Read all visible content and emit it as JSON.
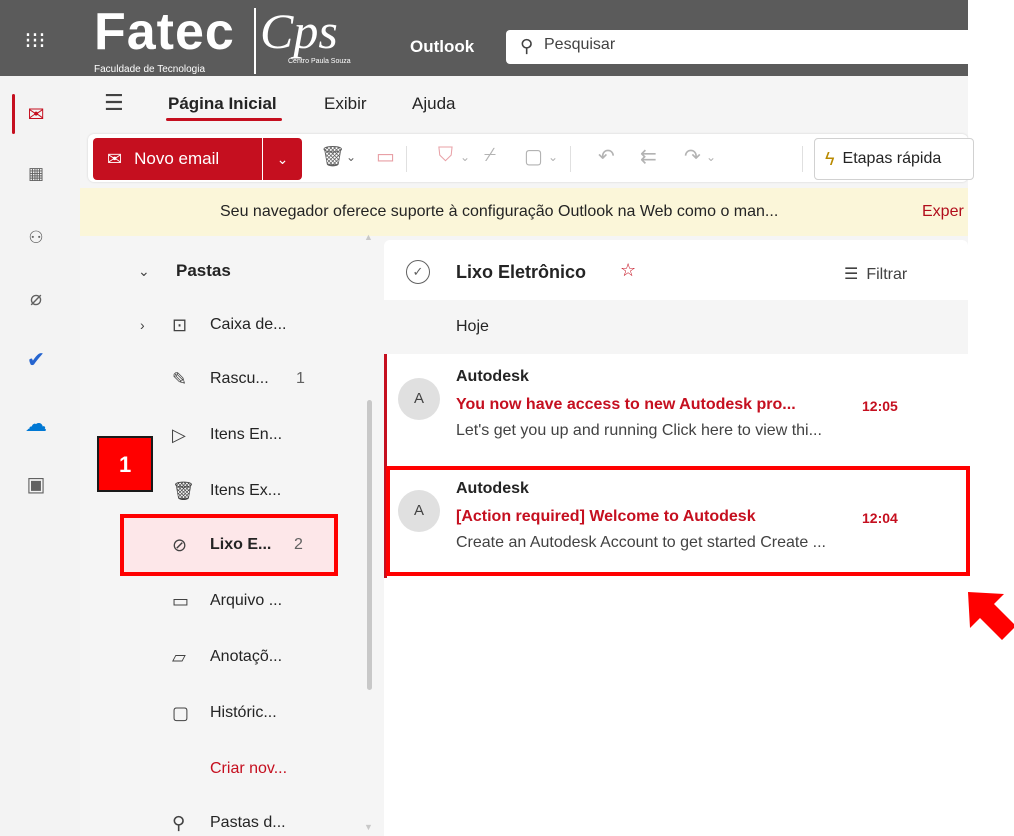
{
  "topbar": {
    "logo_main": "Fatec",
    "logo_sub": "Faculdade de Tecnologia",
    "logo_partner": "Cps",
    "logo_partner_sub": "Centro Paula Souza",
    "app_name": "Outlook",
    "search_placeholder": "Pesquisar"
  },
  "rail": {
    "items": [
      {
        "name": "mail-icon",
        "glyph": "✉",
        "color": "#c50f1f"
      },
      {
        "name": "calendar-icon",
        "glyph": "▦",
        "color": "#616161"
      },
      {
        "name": "people-icon",
        "glyph": "👥",
        "color": "#616161"
      },
      {
        "name": "attachment-icon",
        "glyph": "📎",
        "color": "#616161"
      },
      {
        "name": "todo-icon",
        "glyph": "✔",
        "color": "#2564cf"
      },
      {
        "name": "onedrive-icon",
        "glyph": "☁",
        "color": "#0078d4"
      },
      {
        "name": "apps-icon",
        "glyph": "▣",
        "color": "#616161"
      }
    ]
  },
  "nav": {
    "tabs": [
      "Página Inicial",
      "Exibir",
      "Ajuda"
    ],
    "active_tab": "Página Inicial"
  },
  "toolbar": {
    "new_mail_label": "Novo email",
    "quick_steps_label": "Etapas rápida"
  },
  "banner": {
    "text": "Seu navegador oferece suporte à configuração Outlook na Web como o man...",
    "link": "Exper"
  },
  "folders": {
    "header": "Pastas",
    "items": [
      {
        "label": "Caixa de...",
        "count": ""
      },
      {
        "label": "Rascu...",
        "count": "1"
      },
      {
        "label": "Itens En...",
        "count": ""
      },
      {
        "label": "Itens Ex...",
        "count": ""
      },
      {
        "label": "Lixo E...",
        "count": "2"
      },
      {
        "label": "Arquivo ...",
        "count": ""
      },
      {
        "label": "Anotaçõ...",
        "count": ""
      },
      {
        "label": "Históric...",
        "count": ""
      }
    ],
    "create_label": "Criar nov...",
    "search_folders_label": "Pastas d..."
  },
  "maillist": {
    "title": "Lixo Eletrônico",
    "filter_label": "Filtrar",
    "group_label": "Hoje",
    "messages": [
      {
        "avatar": "A",
        "sender": "Autodesk",
        "subject": "You now have access to new Autodesk pro...",
        "time": "12:05",
        "preview": "Let's get you up and running Click here to view thi..."
      },
      {
        "avatar": "A",
        "sender": "Autodesk",
        "subject": "[Action required] Welcome to Autodesk",
        "time": "12:04",
        "preview": "Create an Autodesk Account to get started Create ..."
      }
    ]
  },
  "annotations": {
    "step_badge": "1",
    "highlight_color": "#ff0000"
  }
}
